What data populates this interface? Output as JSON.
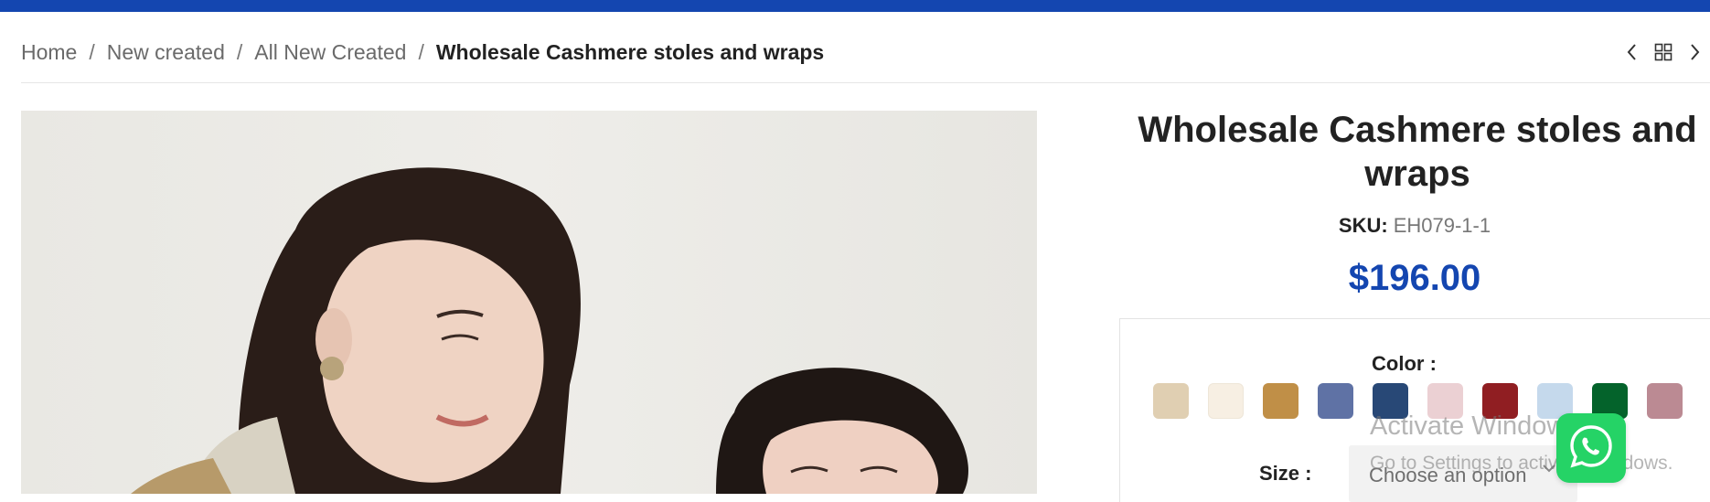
{
  "breadcrumb": {
    "items": [
      "Home",
      "New created",
      "All New Created"
    ],
    "current": "Wholesale Cashmere stoles and wraps",
    "separator": "/"
  },
  "nav": {
    "icons": [
      "chevron-left-icon",
      "grid-icon",
      "chevron-right-icon"
    ]
  },
  "product": {
    "title": "Wholesale Cashmere stoles and wraps",
    "sku_label": "SKU:",
    "sku": "EH079-1-1",
    "price": "$196.00"
  },
  "options": {
    "color_label": "Color",
    "colors": [
      "#e0cfb2",
      "#f7efe3",
      "#c08f47",
      "#5f72a5",
      "#284876",
      "#ebd0d3",
      "#901e22",
      "#c5d9ec",
      "#04632b",
      "#bb8a93"
    ],
    "size_label": "Size",
    "size_placeholder": "Choose an option"
  },
  "watermark": {
    "title": "Activate Windows",
    "subtitle": "Go to Settings to activate Windows."
  },
  "theme": {
    "accent": "#1446b0",
    "whatsapp": "#25d366"
  }
}
